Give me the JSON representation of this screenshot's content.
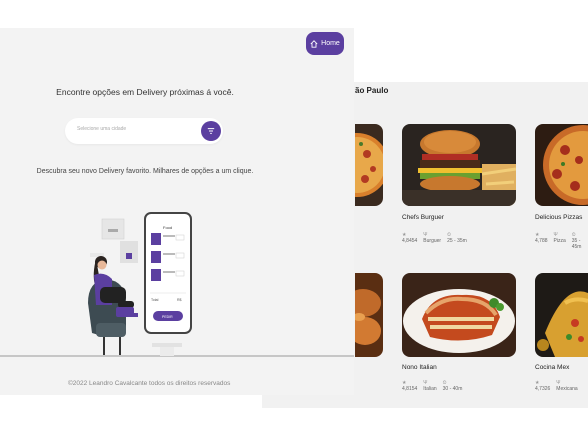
{
  "header": {
    "home_label": "Home"
  },
  "hero": {
    "headline": "Encontre opções em Delivery próximas á você.",
    "search_placeholder": "Selecione uma cidade",
    "subtitle": "Descubra seu novo Delivery favorito. Milhares de opções a um clique."
  },
  "footer": {
    "copyright": "©2022 Leandro Cavalcante todos os direitos reservados"
  },
  "results": {
    "title_fragment": "ão Paulo",
    "cards": [
      {
        "name": "Chefs Burguer",
        "rating": "4,8454",
        "category": "Burguer",
        "time": "25 - 35m"
      },
      {
        "name": "Delicious Pizzas",
        "rating": "4,788",
        "category": "Pizza",
        "time": "35 - 45m"
      },
      {
        "name": "Nono Italian",
        "rating": "4,8154",
        "category": "Italian",
        "time": "30 - 40m"
      },
      {
        "name": "Cocina Mex",
        "rating": "4,7326",
        "category": "Mexicana",
        "time": "30 - 40m"
      }
    ]
  },
  "phone": {
    "brand": "Food",
    "total_label": "Total",
    "total_value": "R$",
    "button_label": "PEDIR"
  },
  "colors": {
    "accent": "#5b3fa0",
    "bg": "#f3f3f3"
  }
}
